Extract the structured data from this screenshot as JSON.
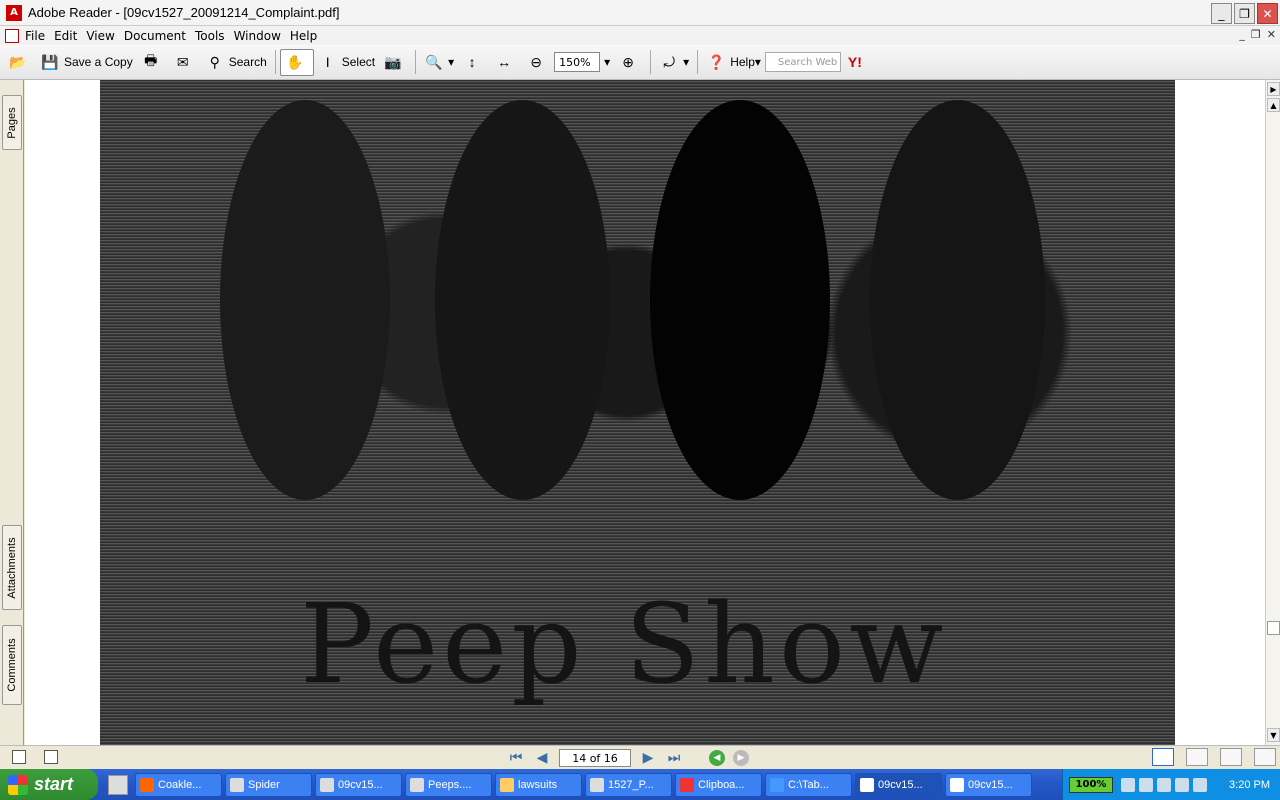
{
  "window": {
    "title": "Adobe Reader - [09cv1527_20091214_Complaint.pdf]"
  },
  "menu": [
    "File",
    "Edit",
    "View",
    "Document",
    "Tools",
    "Window",
    "Help"
  ],
  "toolbar": {
    "save_copy": "Save a Copy",
    "search": "Search",
    "select": "Select",
    "zoom": "150%",
    "help": "Help",
    "search_web_placeholder": "Search Web"
  },
  "side_tabs": {
    "pages": "Pages",
    "attachments": "Attachments",
    "comments": "Comments"
  },
  "document": {
    "page_text": "Peep Show"
  },
  "navigation": {
    "page": "14 of 16"
  },
  "taskbar": {
    "start": "start",
    "tasks": [
      "Coakle...",
      "Spider",
      "09cv15...",
      "Peeps....",
      "lawsuits",
      "1527_P...",
      "Clipboa...",
      "C:\\Tab...",
      "09cv15...",
      "09cv15..."
    ],
    "battery": "100%",
    "clock": "3:20 PM"
  }
}
